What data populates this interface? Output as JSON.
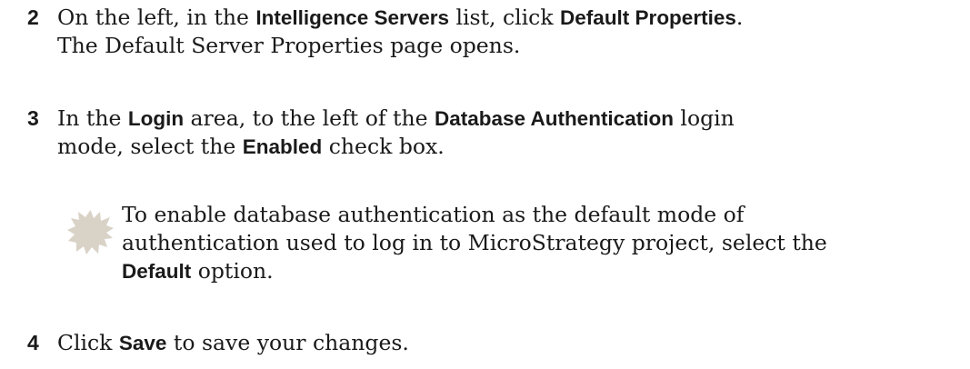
{
  "steps": [
    {
      "number": "2",
      "p1": "On the left, in the ",
      "b1": "Intelligence Servers",
      "p2": " list, click ",
      "b2": "Default Properties",
      "p3": ".",
      "line2": "The Default Server Properties page opens."
    },
    {
      "number": "3",
      "p1": "In the ",
      "b1": "Login",
      "p2": " area, to the left of the ",
      "b2": "Database Authentication",
      "p3": " login",
      "p4": "mode, select the ",
      "b3": "Enabled",
      "p5": " check box."
    },
    {
      "number": "4",
      "p1": "Click ",
      "b1": "Save",
      "p2": " to save your changes."
    }
  ],
  "note": {
    "icon": "note-burst-icon",
    "icon_color": "#d9d2c7",
    "line1": "To enable database authentication as the default mode of",
    "line2": "authentication used to log in to MicroStrategy project, select the",
    "b1": "Default",
    "p1": " option."
  }
}
